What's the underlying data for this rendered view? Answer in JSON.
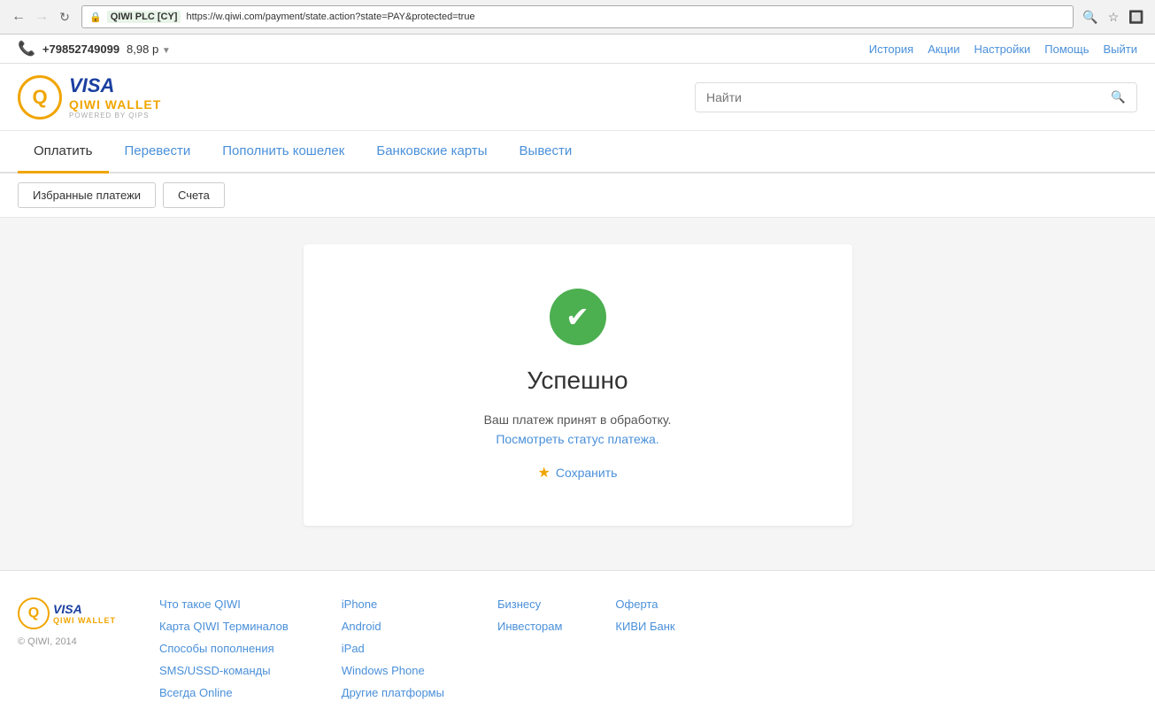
{
  "browser": {
    "url_site": "QIWI PLC [CY]",
    "url_full": "https://w.qiwi.com/payment/state.action?state=PAY&protected=true",
    "lock_icon": "🔒"
  },
  "topbar": {
    "phone": "+79852749099",
    "balance": "8,98 р",
    "nav": {
      "history": "История",
      "promo": "Акции",
      "settings": "Настройки",
      "help": "Помощь",
      "logout": "Выйти"
    }
  },
  "header": {
    "search_placeholder": "Найти"
  },
  "main_nav": {
    "items": [
      {
        "id": "pay",
        "label": "Оплатить",
        "active": true
      },
      {
        "id": "transfer",
        "label": "Перевести",
        "active": false
      },
      {
        "id": "topup",
        "label": "Пополнить кошелек",
        "active": false
      },
      {
        "id": "cards",
        "label": "Банковские карты",
        "active": false
      },
      {
        "id": "withdraw",
        "label": "Вывести",
        "active": false
      }
    ]
  },
  "sub_nav": {
    "favorites": "Избранные платежи",
    "accounts": "Счета"
  },
  "success_card": {
    "title": "Успешно",
    "description": "Ваш платеж принят в обработку.",
    "status_link": "Посмотреть статус платежа.",
    "save_label": "Сохранить"
  },
  "footer": {
    "copyright": "© QIWI, 2014",
    "col1": {
      "items": [
        "Что такое QIWI",
        "Карта QIWI Терминалов",
        "Способы пополнения",
        "SMS/USSD-команды",
        "Всегда Online"
      ]
    },
    "col2": {
      "items": [
        "iPhone",
        "Android",
        "iPad",
        "Windows Phone",
        "Другие платформы"
      ]
    },
    "col3": {
      "items": [
        "Бизнесу",
        "Инвесторам"
      ]
    },
    "col4": {
      "items": [
        "Оферта",
        "КИВИ Банк"
      ]
    }
  }
}
